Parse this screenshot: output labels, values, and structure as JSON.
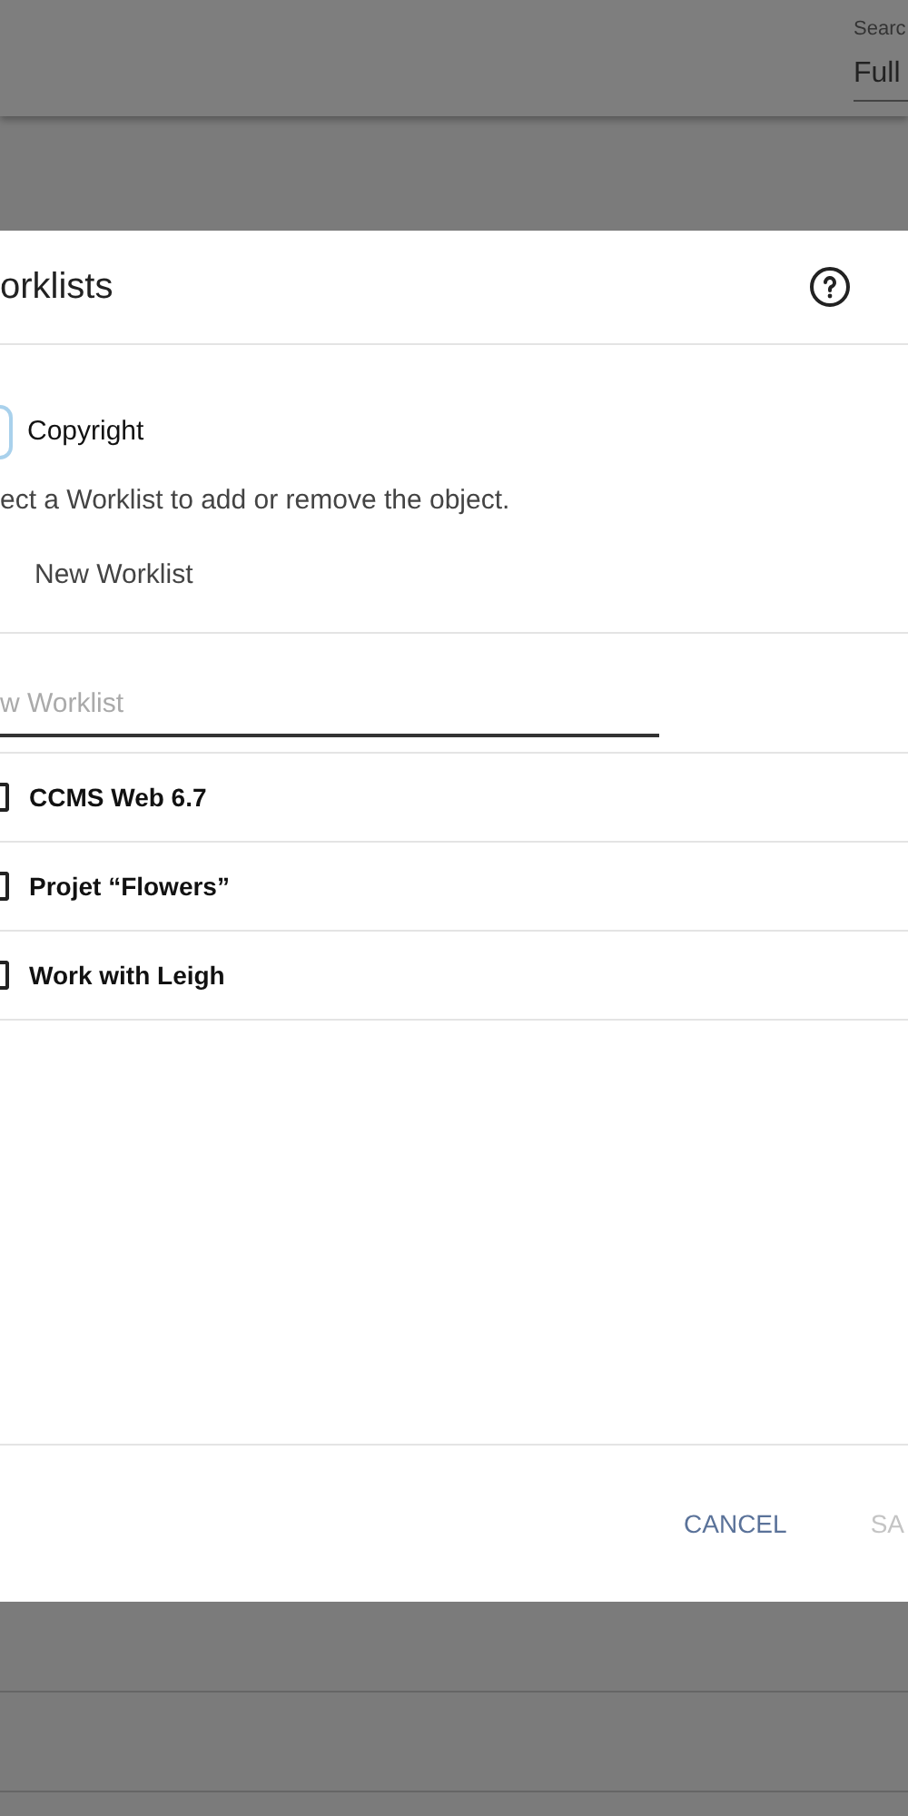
{
  "search": {
    "label": "Searc",
    "value": "Full "
  },
  "dialog": {
    "title": "orklists",
    "object": "Copyright",
    "instruction": "ect a Worklist to add or remove the object.",
    "new_worklist": "New Worklist",
    "name_field": {
      "placeholder": "w Worklist"
    },
    "worklists": [
      {
        "name": "CCMS Web 6.7",
        "checked": false
      },
      {
        "name": "Projet “Flowers”",
        "checked": false
      },
      {
        "name": "Work with Leigh",
        "checked": false
      }
    ],
    "buttons": [
      {
        "label": "CANCEL",
        "disabled": false
      },
      {
        "label": "SA",
        "disabled": true
      }
    ]
  }
}
